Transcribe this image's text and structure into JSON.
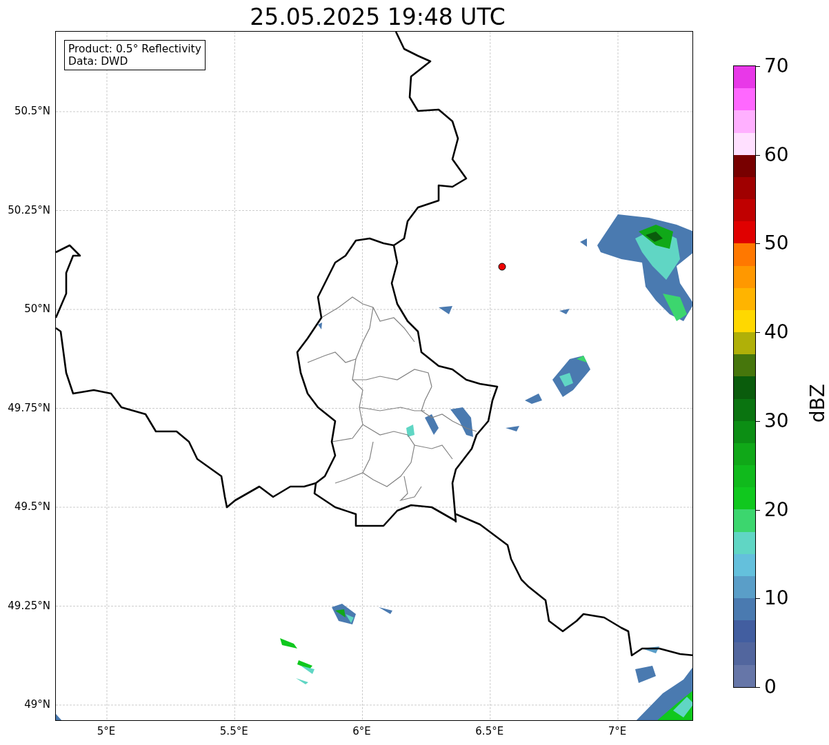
{
  "title": "25.05.2025 19:48 UTC",
  "info_box": {
    "lines": [
      "Product: 0.5° Reflectivity",
      "Data: DWD"
    ]
  },
  "map": {
    "lat_ticks": [
      "50.5°N",
      "50.25°N",
      "50°N",
      "49.75°N",
      "49.5°N",
      "49.25°N",
      "49°N"
    ],
    "lon_ticks": [
      "5°E",
      "5.5°E",
      "6°E",
      "6.5°E",
      "7°E"
    ]
  },
  "colorbar": {
    "label": "dBZ",
    "ticks": [
      "70",
      "60",
      "50",
      "40",
      "30",
      "20",
      "10",
      "0"
    ],
    "bands": [
      {
        "color": "#e838e8"
      },
      {
        "color": "#ff68ff"
      },
      {
        "color": "#ffb0ff"
      },
      {
        "color": "#ffe0ff"
      },
      {
        "color": "#780000"
      },
      {
        "color": "#a00000"
      },
      {
        "color": "#c00000"
      },
      {
        "color": "#e00000"
      },
      {
        "color": "#ff7800"
      },
      {
        "color": "#ff9800"
      },
      {
        "color": "#ffb400"
      },
      {
        "color": "#ffd800"
      },
      {
        "color": "#b0b008"
      },
      {
        "color": "#46760c"
      },
      {
        "color": "#0a5c0c"
      },
      {
        "color": "#0a7410"
      },
      {
        "color": "#0c8e14"
      },
      {
        "color": "#10a818"
      },
      {
        "color": "#10ba1c"
      },
      {
        "color": "#10c81e"
      },
      {
        "color": "#3cd66e"
      },
      {
        "color": "#60d6c4"
      },
      {
        "color": "#64c0dc"
      },
      {
        "color": "#5a9ec8"
      },
      {
        "color": "#4a7ab0"
      },
      {
        "color": "#425ea0"
      },
      {
        "color": "#52669e"
      },
      {
        "color": "#6676a8"
      }
    ]
  }
}
